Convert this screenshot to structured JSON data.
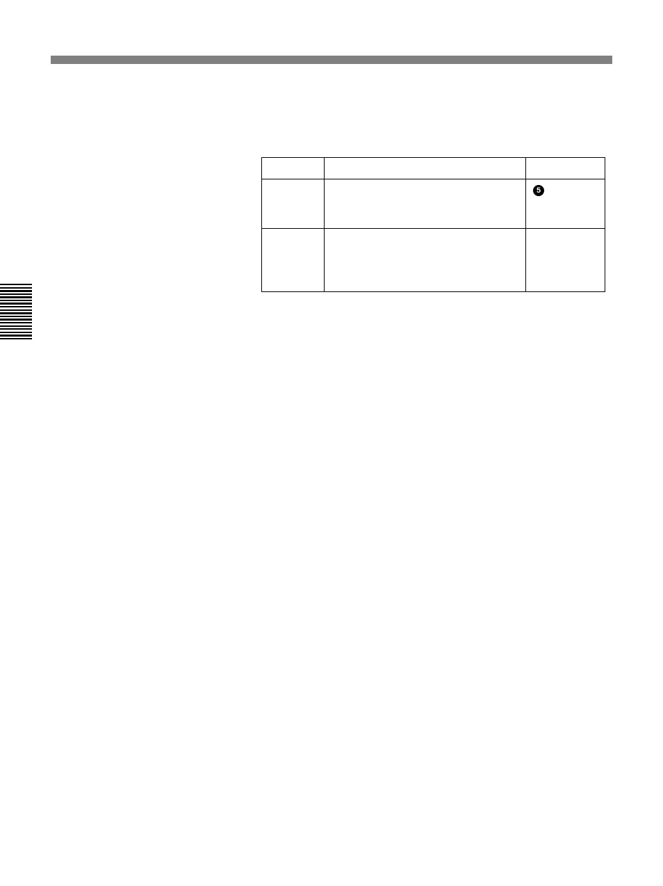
{
  "table": {
    "header": [
      "",
      "",
      ""
    ],
    "rows": [
      [
        "",
        "",
        ""
      ],
      [
        "",
        "",
        ""
      ]
    ],
    "badge": "5"
  }
}
